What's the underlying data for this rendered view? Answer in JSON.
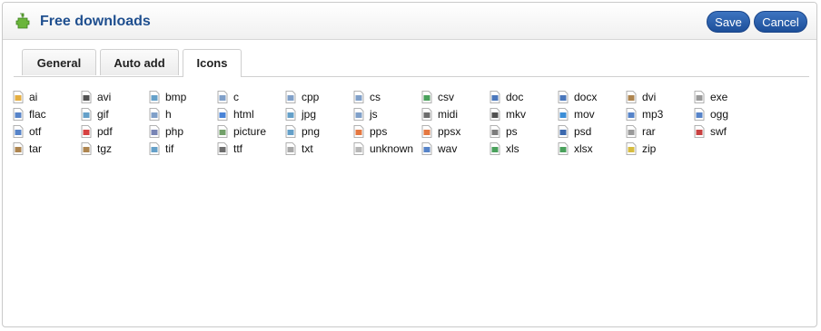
{
  "header": {
    "title": "Free downloads",
    "save_label": "Save",
    "cancel_label": "Cancel",
    "icon": "puzzle-icon"
  },
  "tabs": [
    {
      "label": "General",
      "active": false
    },
    {
      "label": "Auto add",
      "active": false
    },
    {
      "label": "Icons",
      "active": true
    }
  ],
  "icons": [
    [
      "ai",
      "flac",
      "otf",
      "tar"
    ],
    [
      "avi",
      "gif",
      "pdf",
      "tgz"
    ],
    [
      "bmp",
      "h",
      "php",
      "tif"
    ],
    [
      "c",
      "html",
      "picture",
      "ttf"
    ],
    [
      "cpp",
      "jpg",
      "png",
      "txt"
    ],
    [
      "cs",
      "js",
      "pps",
      "unknown"
    ],
    [
      "csv",
      "midi",
      "ppsx",
      "wav"
    ],
    [
      "doc",
      "mkv",
      "ps",
      "xls"
    ],
    [
      "docx",
      "mov",
      "psd",
      "xlsx"
    ],
    [
      "dvi",
      "mp3",
      "rar",
      "zip"
    ],
    [
      "exe",
      "ogg",
      "swf"
    ]
  ],
  "colors": {
    "accent": "#1f4f8f",
    "button": "#2a5fac"
  }
}
